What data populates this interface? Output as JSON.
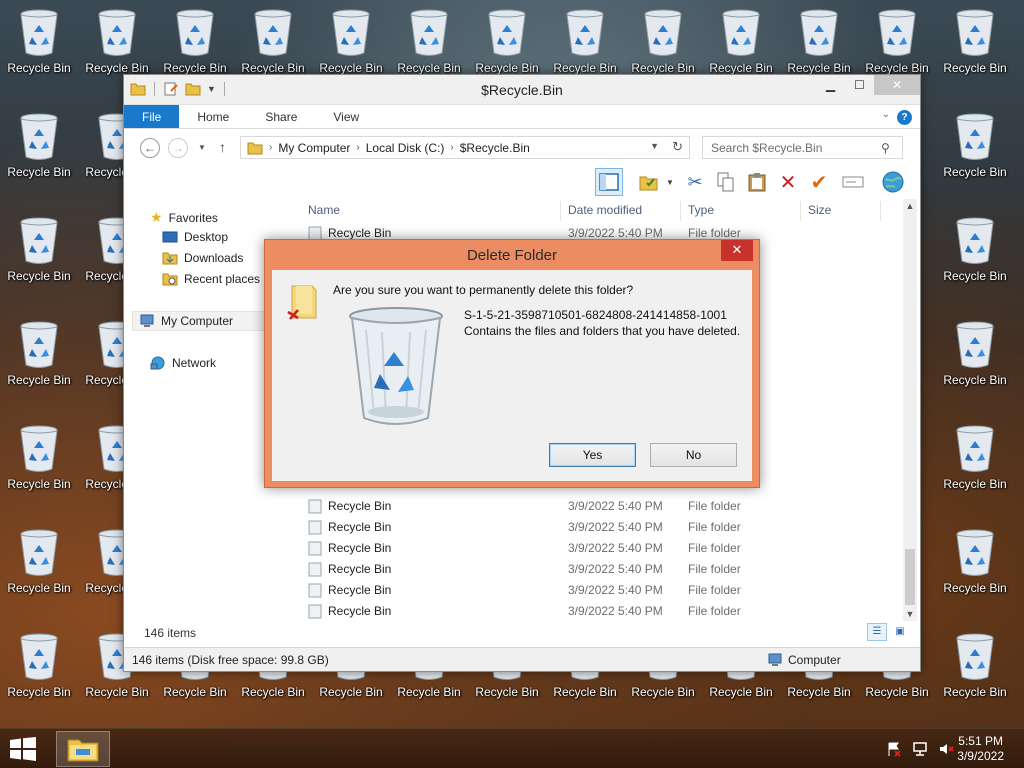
{
  "desktop": {
    "icon_label": "Recycle Bin"
  },
  "explorer": {
    "title": "$Recycle.Bin",
    "tabs": [
      "File",
      "Home",
      "Share",
      "View"
    ],
    "breadcrumb": [
      "My Computer",
      "Local Disk (C:)",
      "$Recycle.Bin"
    ],
    "search_placeholder": "Search $Recycle.Bin",
    "nav": {
      "favorites": "Favorites",
      "desktop": "Desktop",
      "downloads": "Downloads",
      "recent": "Recent places",
      "computer": "My Computer",
      "network": "Network"
    },
    "columns": {
      "name": "Name",
      "date": "Date modified",
      "type": "Type",
      "size": "Size"
    },
    "rows": [
      {
        "name": "Recycle Bin",
        "date": "3/9/2022 5:40 PM",
        "type": "File folder"
      },
      {
        "name": "Recycle Bin",
        "date": "3/9/2022 5:40 PM",
        "type": "File folder"
      },
      {
        "name": "Recycle Bin",
        "date": "3/9/2022 5:40 PM",
        "type": "File folder"
      },
      {
        "name": "Recycle Bin",
        "date": "3/9/2022 5:40 PM",
        "type": "File folder"
      },
      {
        "name": "Recycle Bin",
        "date": "3/9/2022 5:40 PM",
        "type": "File folder"
      },
      {
        "name": "Recycle Bin",
        "date": "3/9/2022 5:40 PM",
        "type": "File folder"
      },
      {
        "name": "Recycle Bin",
        "date": "3/9/2022 5:40 PM",
        "type": "File folder"
      }
    ],
    "item_count": "146 items",
    "status_left": "146 items (Disk free space: 99.8 GB)",
    "status_right": "Computer"
  },
  "dialog": {
    "title": "Delete Folder",
    "question": "Are you sure you want to permanently delete this folder?",
    "folder_name": "S-1-5-21-3598710501-6824808-241414858-1001",
    "folder_desc": "Contains the files and folders that you have deleted.",
    "yes": "Yes",
    "no": "No"
  },
  "taskbar": {
    "time": "5:51 PM",
    "date": "3/9/2022"
  }
}
